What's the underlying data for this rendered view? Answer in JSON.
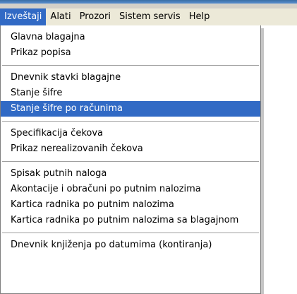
{
  "menubar": {
    "items": [
      {
        "label": "Izveštaji",
        "active": true
      },
      {
        "label": "Alati"
      },
      {
        "label": "Prozori"
      },
      {
        "label": "Sistem servis"
      },
      {
        "label": "Help"
      }
    ]
  },
  "menu": {
    "groups": [
      {
        "items": [
          "Glavna blagajna",
          "Prikaz popisa"
        ]
      },
      {
        "items": [
          "Dnevnik stavki blagajne",
          "Stanje šifre",
          "Stanje šifre po računima"
        ]
      },
      {
        "items": [
          "Specifikacija čekova",
          "Prikaz nerealizovanih čekova"
        ]
      },
      {
        "items": [
          "Spisak putnih naloga",
          "Akontacije i obračuni po putnim nalozima",
          "Kartica radnika po putnim nalozima",
          "Kartica radnika po putnim nalozima sa blagajnom"
        ]
      },
      {
        "items": [
          "Dnevnik knjiženja po datumima (kontiranja)"
        ]
      }
    ],
    "highlighted": "Stanje šifre po računima"
  },
  "colors": {
    "highlight": "#316ac5",
    "menubar_bg": "#ece9d8",
    "separator": "#a0a0a0"
  }
}
